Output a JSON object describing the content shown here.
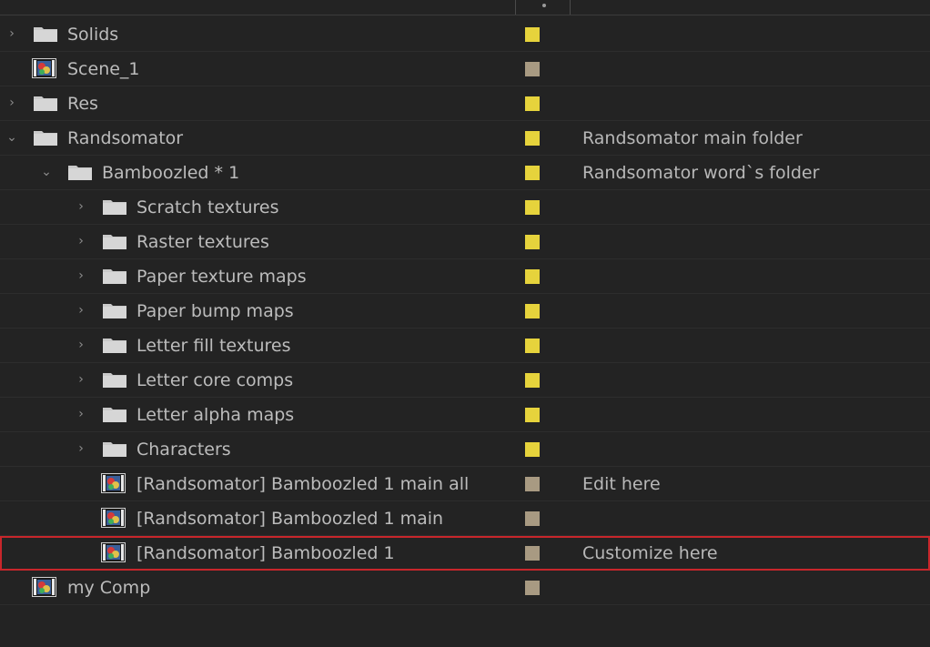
{
  "colors": {
    "folder_label": "#e6d33c",
    "comp_label": "#a89a82",
    "highlight": "#c8262b",
    "background": "#232323"
  },
  "rows": [
    {
      "name": "Solids",
      "type": "folder",
      "arrow": "collapsed",
      "indent": 0,
      "label": "folder",
      "comment": ""
    },
    {
      "name": "Scene_1",
      "type": "comp",
      "arrow": "none",
      "indent": 0,
      "label": "comp",
      "comment": ""
    },
    {
      "name": "Res",
      "type": "folder",
      "arrow": "collapsed",
      "indent": 0,
      "label": "folder",
      "comment": ""
    },
    {
      "name": "Randsomator",
      "type": "folder",
      "arrow": "expanded",
      "indent": 0,
      "label": "folder",
      "comment": "Randsomator main folder"
    },
    {
      "name": "Bamboozled * 1",
      "type": "folder",
      "arrow": "expanded",
      "indent": 1,
      "label": "folder",
      "comment": "Randsomator word`s folder"
    },
    {
      "name": "Scratch textures",
      "type": "folder",
      "arrow": "collapsed",
      "indent": 2,
      "label": "folder",
      "comment": ""
    },
    {
      "name": "Raster textures",
      "type": "folder",
      "arrow": "collapsed",
      "indent": 2,
      "label": "folder",
      "comment": ""
    },
    {
      "name": "Paper texture maps",
      "type": "folder",
      "arrow": "collapsed",
      "indent": 2,
      "label": "folder",
      "comment": ""
    },
    {
      "name": "Paper bump maps",
      "type": "folder",
      "arrow": "collapsed",
      "indent": 2,
      "label": "folder",
      "comment": ""
    },
    {
      "name": "Letter fill textures",
      "type": "folder",
      "arrow": "collapsed",
      "indent": 2,
      "label": "folder",
      "comment": ""
    },
    {
      "name": "Letter core comps",
      "type": "folder",
      "arrow": "collapsed",
      "indent": 2,
      "label": "folder",
      "comment": ""
    },
    {
      "name": "Letter alpha maps",
      "type": "folder",
      "arrow": "collapsed",
      "indent": 2,
      "label": "folder",
      "comment": ""
    },
    {
      "name": "Characters",
      "type": "folder",
      "arrow": "collapsed",
      "indent": 2,
      "label": "folder",
      "comment": ""
    },
    {
      "name": "[Randsomator] Bamboozled 1 main all",
      "type": "comp",
      "arrow": "none",
      "indent": 2,
      "label": "comp",
      "comment": "Edit here"
    },
    {
      "name": "[Randsomator] Bamboozled 1 main",
      "type": "comp",
      "arrow": "none",
      "indent": 2,
      "label": "comp",
      "comment": ""
    },
    {
      "name": "[Randsomator] Bamboozled 1",
      "type": "comp",
      "arrow": "none",
      "indent": 2,
      "label": "comp",
      "comment": "Customize here",
      "highlighted": true
    },
    {
      "name": "my Comp",
      "type": "comp",
      "arrow": "none",
      "indent": 0,
      "label": "comp",
      "comment": ""
    }
  ]
}
